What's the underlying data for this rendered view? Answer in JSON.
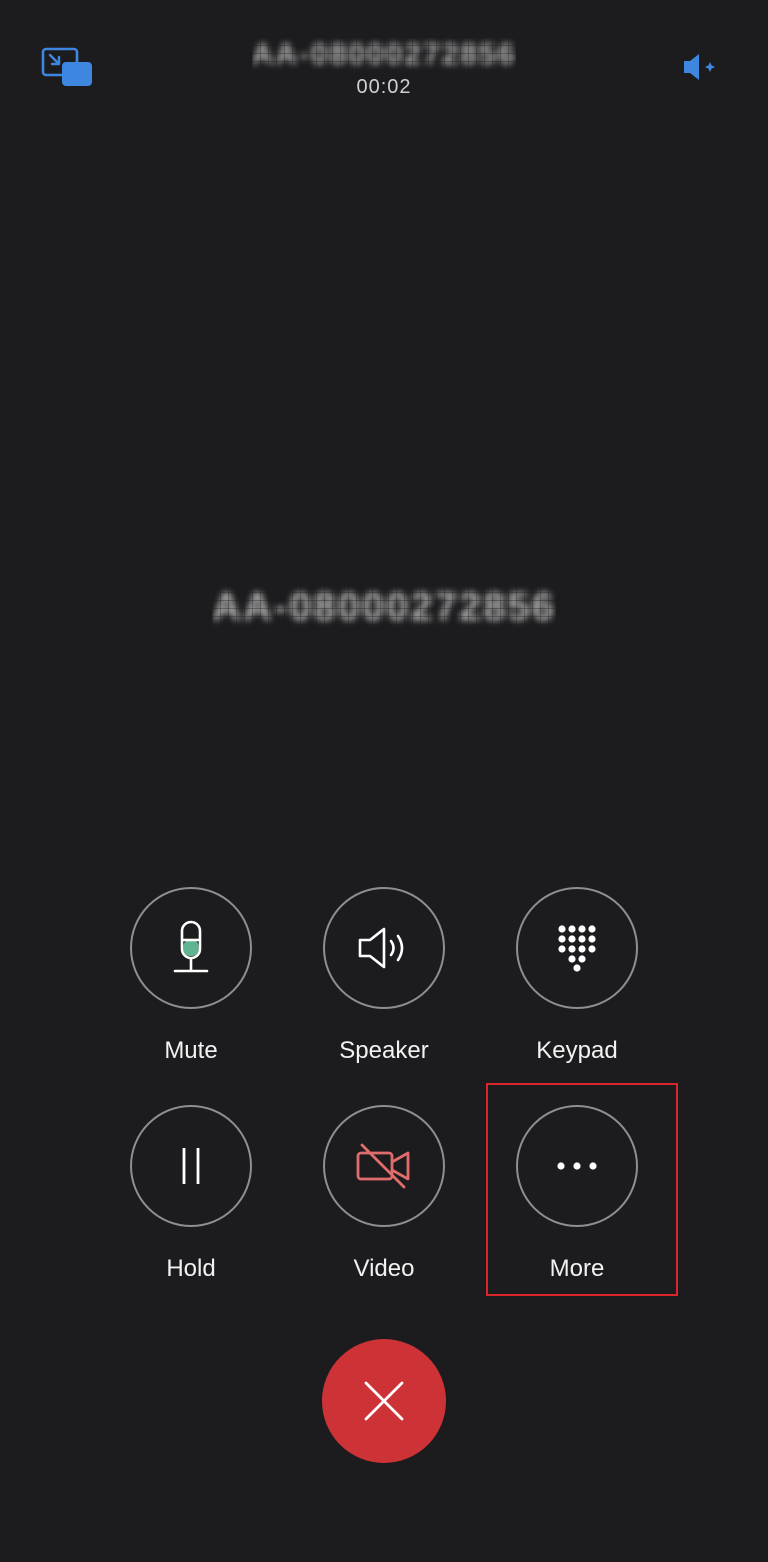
{
  "header": {
    "caller_id_redacted": "AA-08000272856",
    "call_timer": "00:02"
  },
  "caller": {
    "display_name_redacted": "AA-08000272856"
  },
  "controls": {
    "row1": [
      {
        "label": "Mute",
        "icon": "microphone-icon"
      },
      {
        "label": "Speaker",
        "icon": "speaker-icon"
      },
      {
        "label": "Keypad",
        "icon": "keypad-icon"
      }
    ],
    "row2": [
      {
        "label": "Hold",
        "icon": "pause-icon"
      },
      {
        "label": "Video",
        "icon": "video-off-icon"
      },
      {
        "label": "More",
        "icon": "more-dots-icon"
      }
    ]
  },
  "end_call": {
    "icon": "close-icon"
  },
  "colors": {
    "background": "#1c1c1e",
    "accent_blue": "#3d87e0",
    "end_call_red": "#cc3236",
    "video_off_red": "#e06c6c",
    "mute_green": "#5fb391",
    "highlight_red": "#d9252b"
  }
}
